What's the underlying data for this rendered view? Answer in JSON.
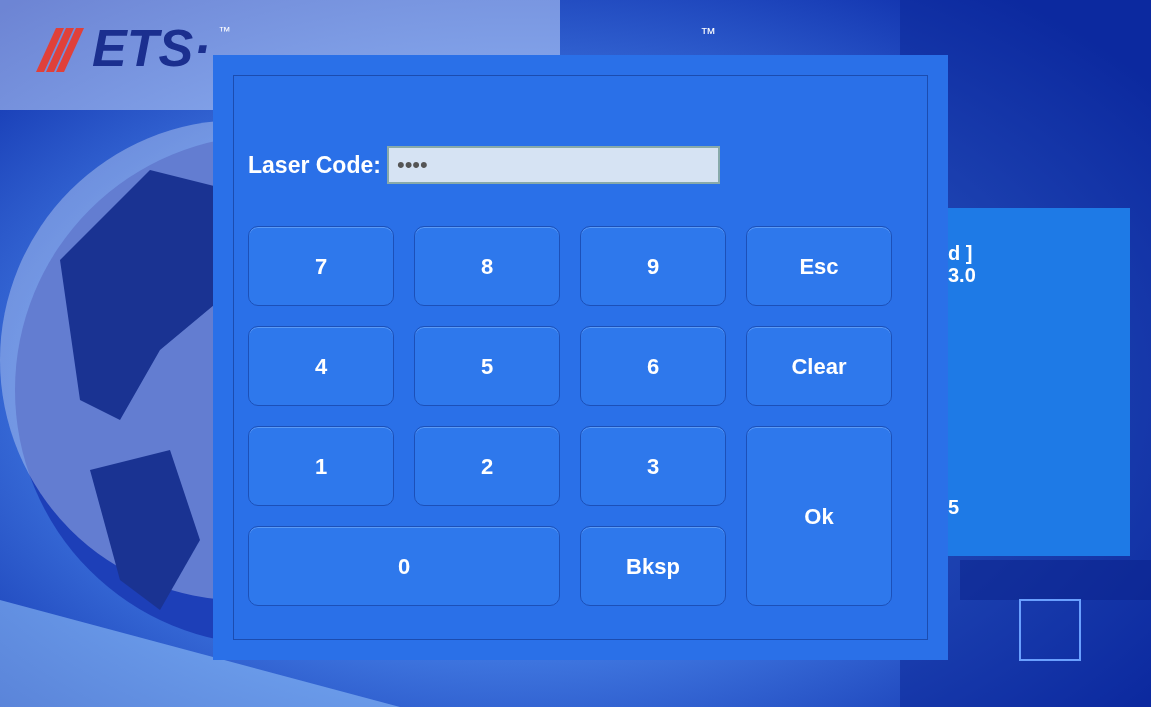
{
  "brand": {
    "company": "ETS·",
    "trademark": "™",
    "product_mark": "™"
  },
  "background_panel": {
    "lines": [
      "d ]",
      "3.0",
      "5"
    ]
  },
  "dialog": {
    "label": "Laser Code:",
    "value": "••••",
    "keys": [
      "7",
      "8",
      "9",
      "Esc",
      "4",
      "5",
      "6",
      "Clear",
      "1",
      "2",
      "3",
      "Ok",
      "0",
      "Bksp"
    ]
  }
}
